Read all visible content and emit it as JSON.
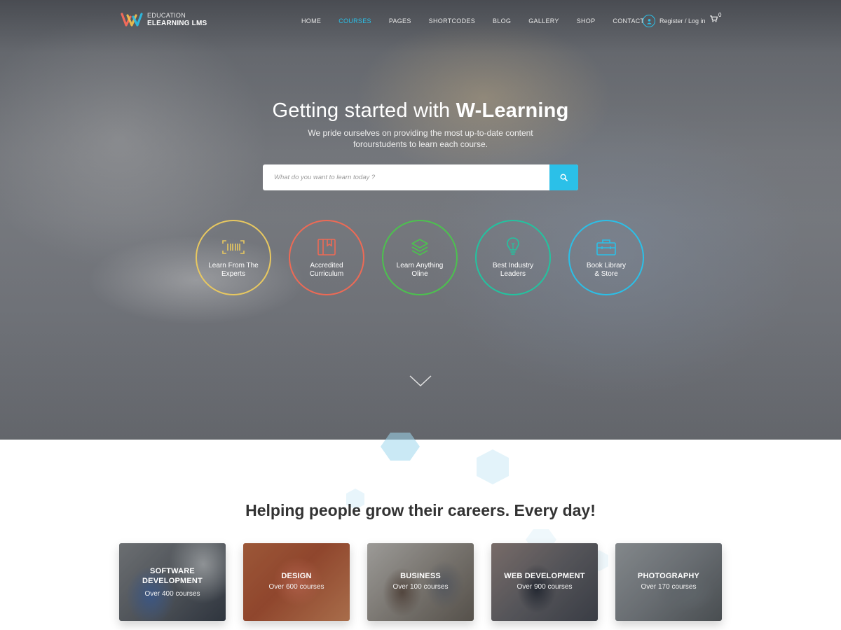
{
  "brand": {
    "small": "EDUCATION",
    "big": "ELEARNING LMS",
    "colors": {
      "accent": "#2bc0e8"
    }
  },
  "nav": {
    "items": [
      {
        "label": "HOME",
        "active": false
      },
      {
        "label": "COURSES",
        "active": true
      },
      {
        "label": "PAGES",
        "active": false
      },
      {
        "label": "SHORTCODES",
        "active": false
      },
      {
        "label": "BLOG",
        "active": false
      },
      {
        "label": "GALLERY",
        "active": false
      },
      {
        "label": "SHOP",
        "active": false
      },
      {
        "label": "CONTACT",
        "active": false
      }
    ],
    "register_label": "Register / Log in",
    "cart_count": "0",
    "icons": {
      "user": "user-icon",
      "cart": "cart-icon"
    }
  },
  "hero": {
    "headline_regular": "Getting started with ",
    "headline_bold": "W-Learning",
    "sub_line1": "We pride ourselves on providing the most up-to-date content",
    "sub_line2": "forourstudents to learn each course.",
    "search_placeholder": "What do you want to learn today ?",
    "search_icon": "search-icon",
    "scroll_icon": "chevron-down-icon"
  },
  "features": [
    {
      "line1": "Learn From The",
      "line2": "Experts",
      "color": "#e8c860",
      "icon": "barcode-icon"
    },
    {
      "line1": "Accredited",
      "line2": "Curriculum",
      "color": "#ee6a55",
      "icon": "book-icon"
    },
    {
      "line1": "Learn Anything",
      "line2": "Oline",
      "color": "#4cc24e",
      "icon": "layers-icon"
    },
    {
      "line1": "Best Industry",
      "line2": "Leaders",
      "color": "#22c4a0",
      "icon": "lightbulb-icon"
    },
    {
      "line1": "Book Library",
      "line2": "& Store",
      "color": "#2bc0e8",
      "icon": "briefcase-icon"
    }
  ],
  "section": {
    "title": "Helping people grow their careers. Every day!"
  },
  "categories": [
    {
      "title_line1": "SOFTWARE",
      "title_line2": "DEVELOPMENT",
      "subtitle": "Over 400 courses"
    },
    {
      "title_line1": "DESIGN",
      "title_line2": "",
      "subtitle": "Over 600 courses"
    },
    {
      "title_line1": "BUSINESS",
      "title_line2": "",
      "subtitle": "Over 100 courses"
    },
    {
      "title_line1": "WEB DEVELOPMENT",
      "title_line2": "",
      "subtitle": "Over 900 courses"
    },
    {
      "title_line1": "PHOTOGRAPHY",
      "title_line2": "",
      "subtitle": "Over 170 courses"
    }
  ]
}
